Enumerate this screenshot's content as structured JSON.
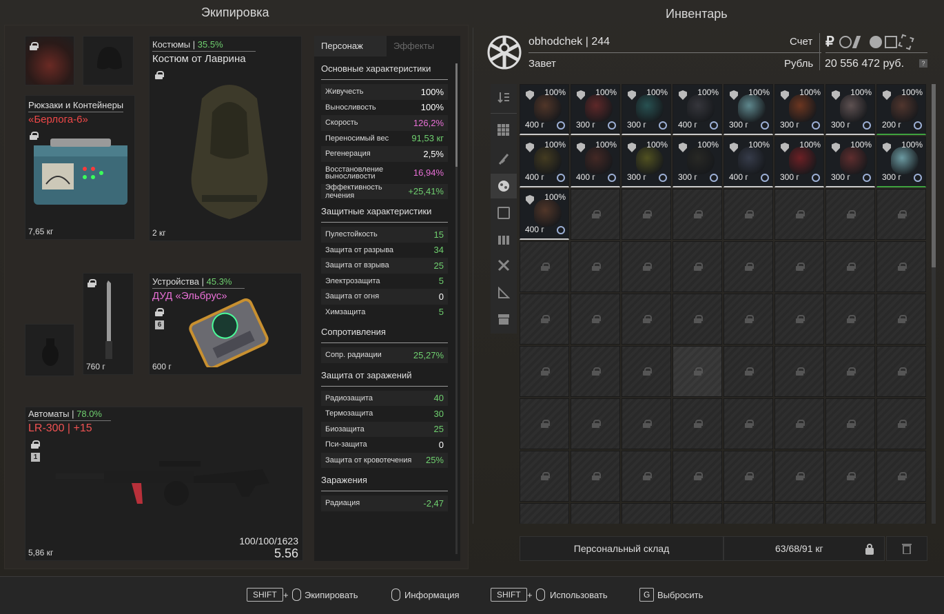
{
  "equipment_title": "Экипировка",
  "inventory_title": "Инвентарь",
  "backpack": {
    "category": "Рюкзаки и Контейнеры",
    "name": "«Берлога-6»",
    "weight": "7,65 кг"
  },
  "armor": {
    "category": "Костюмы",
    "percent": "35.5%",
    "name": "Костюм от Лаврина",
    "weight": "2 кг"
  },
  "melee": {
    "weight": "760 г"
  },
  "device": {
    "category": "Устройства",
    "percent": "45.3%",
    "name": "ДУД «Эльбрус»",
    "badge": "6",
    "weight": "600 г"
  },
  "weapon": {
    "category": "Автоматы",
    "percent": "78.0%",
    "name": "LR-300 | +15",
    "badge": "1",
    "ammo": "100/100/1623",
    "value": "5.56",
    "weight": "5,86 кг"
  },
  "stats_tabs": [
    "Персонаж",
    "Эффекты"
  ],
  "stats": {
    "basic_title": "Основные характеристики",
    "basic": [
      {
        "label": "Живучесть",
        "value": "100%",
        "color": "#ffffff"
      },
      {
        "label": "Выносливость",
        "value": "100%",
        "color": "#ffffff"
      },
      {
        "label": "Скорость",
        "value": "126,2%",
        "color": "#e870d6"
      },
      {
        "label": "Переносимый вес",
        "value": "91,53 кг",
        "color": "#6fd06f"
      },
      {
        "label": "Регенерация",
        "value": "2,5%",
        "color": "#ffffff"
      },
      {
        "label": "Восстановление выносливости",
        "value": "16,94%",
        "color": "#e870d6"
      },
      {
        "label": "Эффективность лечения",
        "value": "+25,41%",
        "color": "#6fd06f"
      }
    ],
    "protect_title": "Защитные характеристики",
    "protect": [
      {
        "label": "Пулестойкость",
        "value": "15",
        "color": "#6fd06f"
      },
      {
        "label": "Защита от разрыва",
        "value": "34",
        "color": "#6fd06f"
      },
      {
        "label": "Защита от взрыва",
        "value": "25",
        "color": "#6fd06f"
      },
      {
        "label": "Электрозащита",
        "value": "5",
        "color": "#6fd06f"
      },
      {
        "label": "Защита от огня",
        "value": "0",
        "color": "#ffffff"
      },
      {
        "label": "Химзащита",
        "value": "5",
        "color": "#6fd06f"
      }
    ],
    "resist_title": "Сопротивления",
    "resist": [
      {
        "label": "Сопр. радиации",
        "value": "25,27%",
        "color": "#6fd06f"
      }
    ],
    "infect_prot_title": "Защита от заражений",
    "infect_prot": [
      {
        "label": "Радиозащита",
        "value": "40",
        "color": "#6fd06f"
      },
      {
        "label": "Термозащита",
        "value": "30",
        "color": "#6fd06f"
      },
      {
        "label": "Биозащита",
        "value": "25",
        "color": "#6fd06f"
      },
      {
        "label": "Пси-защита",
        "value": "0",
        "color": "#ffffff"
      },
      {
        "label": "Защита от кровотечения",
        "value": "25%",
        "color": "#6fd06f"
      }
    ],
    "infect_title": "Заражения",
    "infect": [
      {
        "label": "Радиация",
        "value": "-2,47",
        "color": "#6fd06f"
      }
    ]
  },
  "player": {
    "name": "obhodchek",
    "level": "244",
    "faction": "Завет",
    "account_label": "Счет",
    "currency_label": "Рубль",
    "balance": "20 556 472 руб.",
    "help": "?"
  },
  "items": [
    {
      "dur": "100%",
      "w": "400 г",
      "c": "#5a3a2a"
    },
    {
      "dur": "100%",
      "w": "300 г",
      "c": "#6a2a2a"
    },
    {
      "dur": "100%",
      "w": "300 г",
      "c": "#2a5a5a"
    },
    {
      "dur": "100%",
      "w": "400 г",
      "c": "#3a3a40"
    },
    {
      "dur": "100%",
      "w": "300 г",
      "c": "#6a9aa0"
    },
    {
      "dur": "100%",
      "w": "300 г",
      "c": "#7a3a20"
    },
    {
      "dur": "100%",
      "w": "300 г",
      "c": "#6a5a5a"
    },
    {
      "dur": "100%",
      "w": "200 г",
      "c": "#5a3a30"
    },
    {
      "dur": "100%",
      "w": "400 г",
      "c": "#4a4020"
    },
    {
      "dur": "100%",
      "w": "400 г",
      "c": "#4a2a25"
    },
    {
      "dur": "100%",
      "w": "300 г",
      "c": "#5a5a20"
    },
    {
      "dur": "100%",
      "w": "300 г",
      "c": "#2a2a25"
    },
    {
      "dur": "100%",
      "w": "400 г",
      "c": "#3a4050"
    },
    {
      "dur": "100%",
      "w": "300 г",
      "c": "#7a2025"
    },
    {
      "dur": "100%",
      "w": "300 г",
      "c": "#6a3030"
    },
    {
      "dur": "100%",
      "w": "300 г",
      "c": "#7ab0b8"
    },
    {
      "dur": "100%",
      "w": "400 г",
      "c": "#5a3a2a"
    }
  ],
  "storage_label": "Персональный склад",
  "storage_weight": "63/68/91 кг",
  "hints": {
    "shift": "SHIFT",
    "plus": "+",
    "equip": "Экипировать",
    "info": "Информация",
    "use": "Использовать",
    "g": "G",
    "drop": "Выбросить"
  }
}
